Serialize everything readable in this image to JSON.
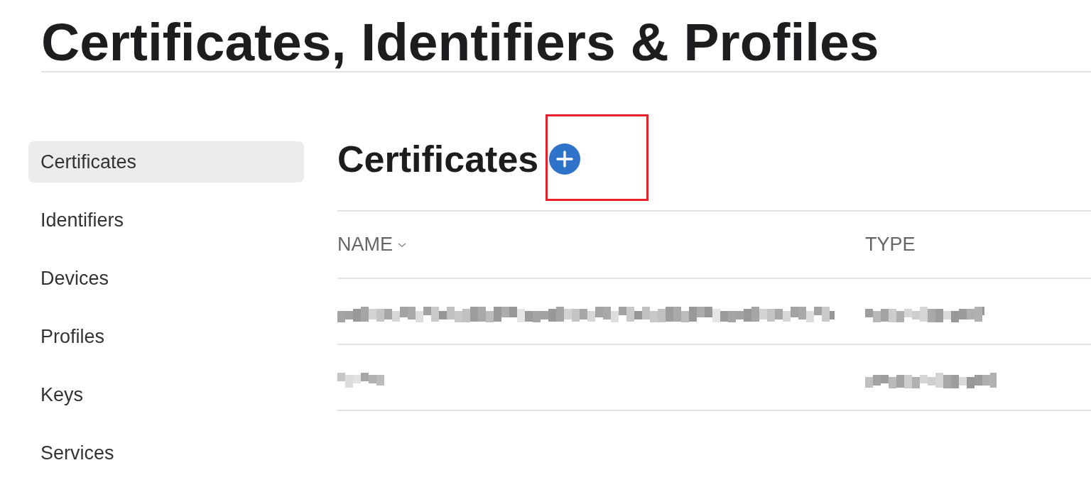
{
  "page_title": "Certificates, Identifiers & Profiles",
  "sidebar": {
    "items": [
      {
        "label": "Certificates",
        "selected": true
      },
      {
        "label": "Identifiers",
        "selected": false
      },
      {
        "label": "Devices",
        "selected": false
      },
      {
        "label": "Profiles",
        "selected": false
      },
      {
        "label": "Keys",
        "selected": false
      },
      {
        "label": "Services",
        "selected": false
      }
    ]
  },
  "section": {
    "title": "Certificates",
    "highlights": [
      {
        "kind": "frame"
      }
    ]
  },
  "table": {
    "columns": [
      {
        "label": "NAME",
        "sortable": true
      },
      {
        "label": "TYPE",
        "sortable": false
      }
    ],
    "rows": [
      {
        "kind": "redacted",
        "name_long": true,
        "type_long": false
      },
      {
        "kind": "redacted",
        "name_long": false,
        "type_long": true
      }
    ]
  }
}
